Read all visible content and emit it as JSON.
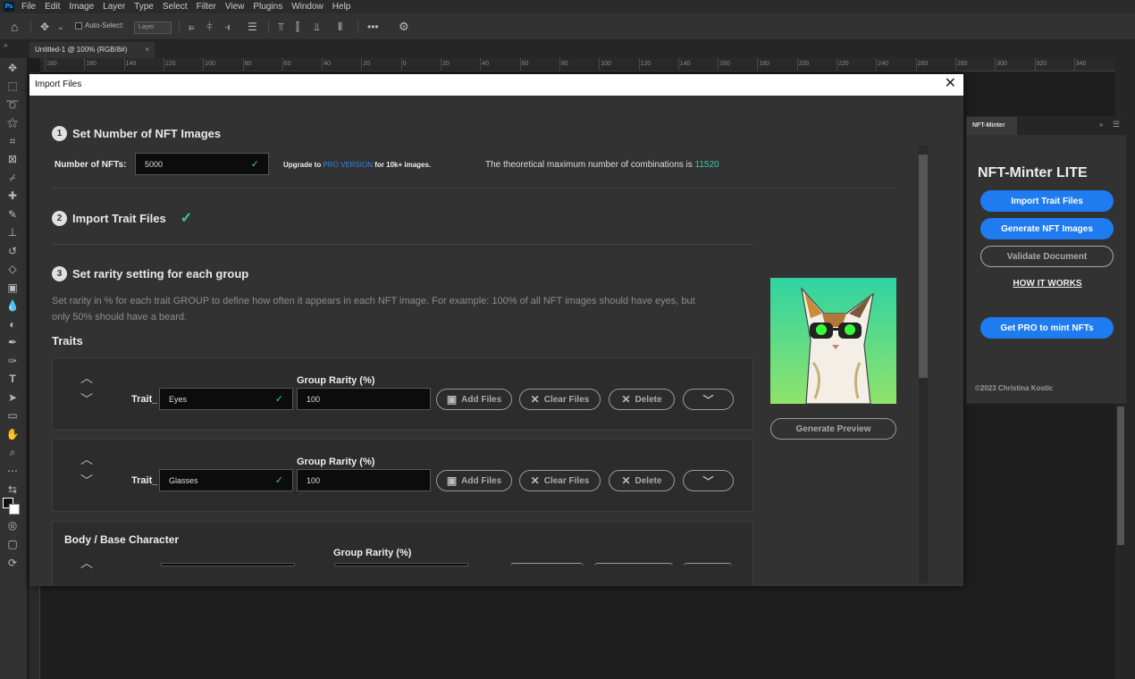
{
  "menubar": {
    "items": [
      "File",
      "Edit",
      "Image",
      "Layer",
      "Type",
      "Select",
      "Filter",
      "View",
      "Plugins",
      "Window",
      "Help"
    ]
  },
  "optionsbar": {
    "autoselect_label": "Auto-Select:",
    "layer_select_value": "Layer"
  },
  "document_tab": {
    "title": "Untitled-1 @ 100% (RGB/8#)",
    "close": "×"
  },
  "ruler": {
    "labels": [
      "180",
      "160",
      "140",
      "120",
      "100",
      "80",
      "60",
      "40",
      "20",
      "0",
      "20",
      "40",
      "60",
      "80",
      "100",
      "120",
      "140",
      "160",
      "180",
      "200",
      "220",
      "240",
      "260",
      "280",
      "300",
      "320",
      "340"
    ]
  },
  "dialog": {
    "title": "Import Files",
    "close": "✕",
    "step1": {
      "num": "1",
      "title": "Set Number of NFT Images",
      "nft_label": "Number of NFTs:",
      "nft_value": "5000",
      "upgrade_prefix": "Upgrade to ",
      "upgrade_link": "PRO VERSION",
      "upgrade_suffix": " for 10k+ images.",
      "max_text": "The theoretical maximum number of combinations is ",
      "max_value": "11520"
    },
    "step2": {
      "num": "2",
      "title": "Import Trait Files"
    },
    "step3": {
      "num": "3",
      "title": "Set rarity setting for each group",
      "description": "Set rarity in % for each trait GROUP to define how often it appears in each NFT image. For example: 100% of all NFT images should have eyes, but only 50% should have a beard.",
      "traits_heading": "Traits"
    },
    "traits": [
      {
        "prefix": "Trait_",
        "name": "Eyes",
        "rarity_label": "Group Rarity (%)",
        "rarity_value": "100",
        "add": "Add Files",
        "clear": "Clear Files",
        "delete": "Delete"
      },
      {
        "prefix": "Trait_",
        "name": "Glasses",
        "rarity_label": "Group Rarity (%)",
        "rarity_value": "100",
        "add": "Add Files",
        "clear": "Clear Files",
        "delete": "Delete"
      }
    ],
    "body_card": {
      "title": "Body / Base Character",
      "rarity_label": "Group Rarity (%)"
    },
    "generate_preview": "Generate Preview"
  },
  "nft_panel": {
    "tab": "NFT-Minter",
    "title": "NFT-Minter LITE",
    "import_btn": "Import Trait Files",
    "generate_btn": "Generate NFT Images",
    "validate_btn": "Validate Document",
    "how_it_works": "HOW IT WORKS",
    "pro_btn": "Get PRO to mint NFTs",
    "copyright": "©2023 Christina Kostic"
  },
  "colors": {
    "accent": "#35c9a8",
    "blue": "#1f7bf0",
    "pro_link": "#2f86e8"
  }
}
